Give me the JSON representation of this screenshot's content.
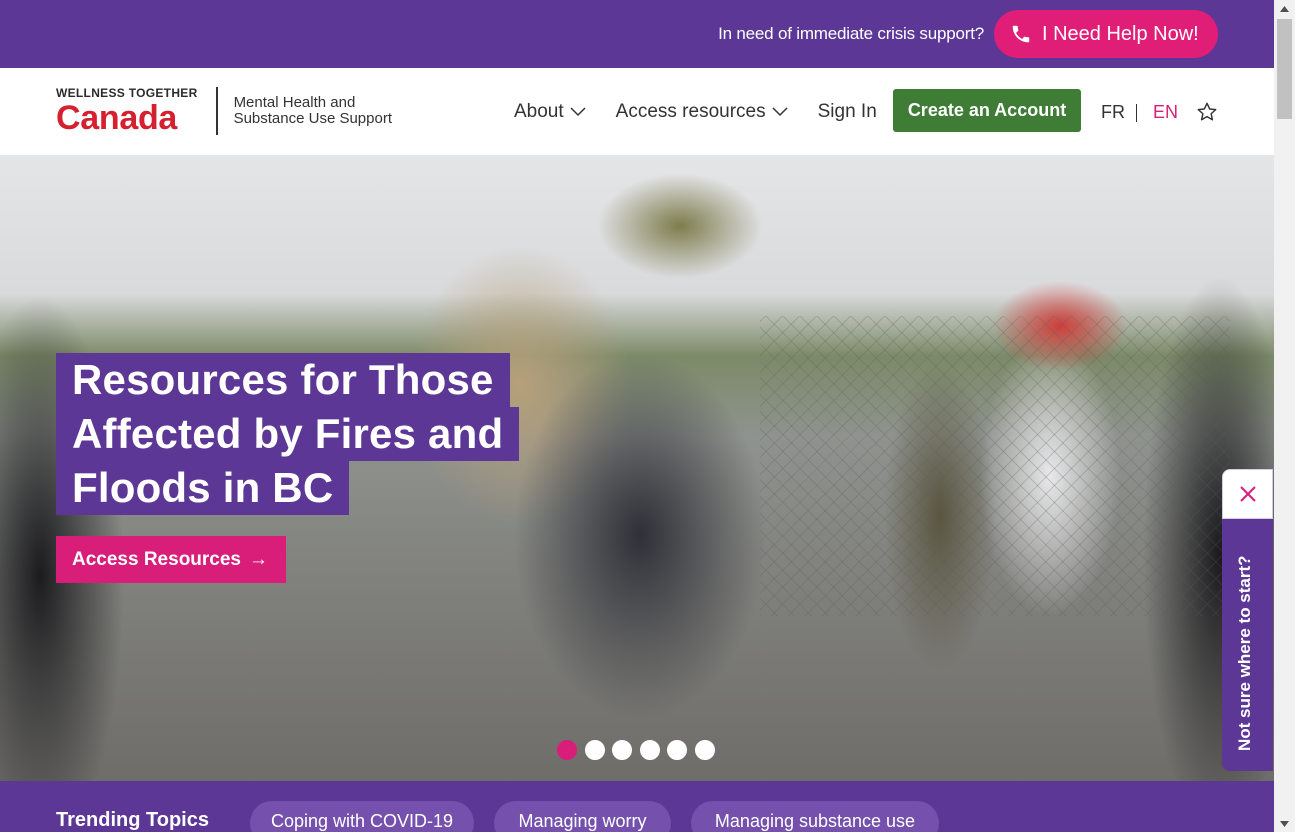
{
  "crisis_bar": {
    "text": "In need of immediate crisis support?",
    "help_button": "I Need Help Now!",
    "help_icon": "phone-icon"
  },
  "header": {
    "logo": {
      "small": "WELLNESS TOGETHER",
      "big": "Canada",
      "tagline_line1": "Mental Health and",
      "tagline_line2": "Substance Use Support"
    },
    "nav": [
      {
        "label": "About",
        "has_dropdown": true
      },
      {
        "label": "Access resources",
        "has_dropdown": true
      },
      {
        "label": "Sign In",
        "has_dropdown": false
      }
    ],
    "create_account": "Create an Account",
    "lang_fr": "FR",
    "lang_en": "EN",
    "favorites_icon": "star-icon"
  },
  "hero": {
    "headline_lines": [
      "Resources for Those",
      "Affected by Fires and",
      "Floods in BC"
    ],
    "cta": "Access Resources",
    "cta_arrow": "→",
    "slides_total": 6,
    "slide_active": 1
  },
  "side_tab": {
    "label": "Not sure where to start?",
    "close_icon": "close-icon"
  },
  "trending": {
    "title": "Trending Topics",
    "chips": [
      "Coping with COVID-19",
      "Managing worry",
      "Managing substance use"
    ]
  },
  "colors": {
    "purple": "#5c3796",
    "pink": "#d81e78",
    "green": "#3f7d36",
    "red": "#d5202f"
  }
}
